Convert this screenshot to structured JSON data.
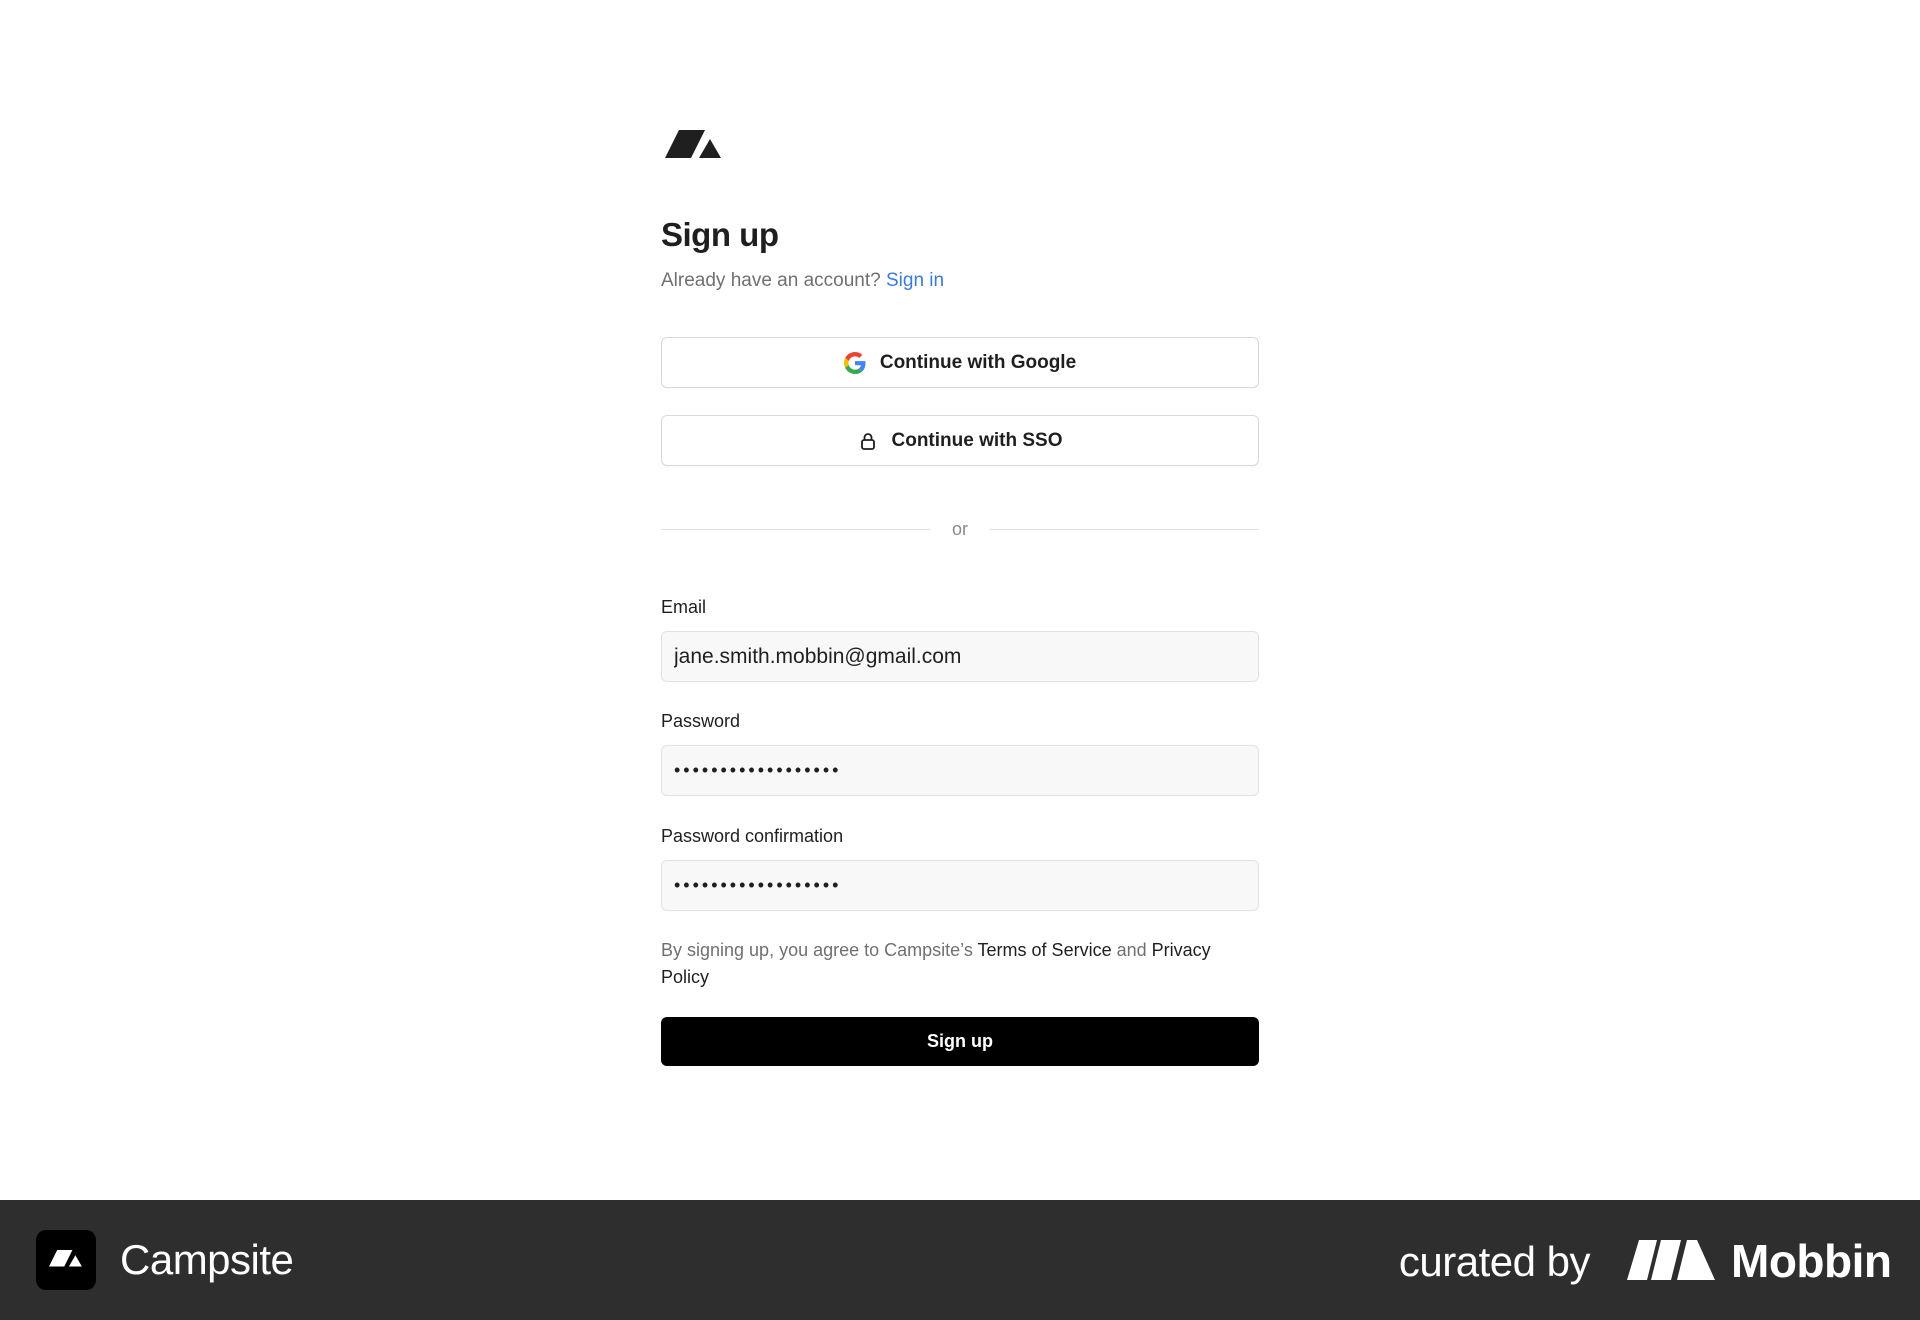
{
  "header": {
    "logo_icon": "campsite-logo-icon",
    "title": "Sign up",
    "subtitle_text": "Already have an account?",
    "sign_in_link": "Sign in"
  },
  "oauth": {
    "google": {
      "label": "Continue with Google",
      "icon": "google-icon"
    },
    "sso": {
      "label": "Continue with SSO",
      "icon": "lock-icon"
    }
  },
  "divider": {
    "label": "or"
  },
  "form": {
    "email": {
      "label": "Email",
      "value": "jane.smith.mobbin@gmail.com"
    },
    "password": {
      "label": "Password",
      "value": "••••••••••••••••••"
    },
    "password_confirmation": {
      "label": "Password confirmation",
      "value": "••••••••••••••••••"
    },
    "terms": {
      "prefix": "By signing up, you agree to Campsite’s",
      "tos_link": "Terms of Service",
      "and": "and",
      "privacy_link": "Privacy Policy"
    },
    "submit_label": "Sign up"
  },
  "footer": {
    "app_name": "Campsite",
    "curated_by": "curated by",
    "brand": "Mobbin",
    "brand_icon": "mobbin-logo-icon"
  },
  "colors": {
    "link": "#3a7bd5",
    "primary_button": "#000000",
    "footer_bg": "#2e2e2e",
    "input_bg": "#f8f8f8"
  }
}
